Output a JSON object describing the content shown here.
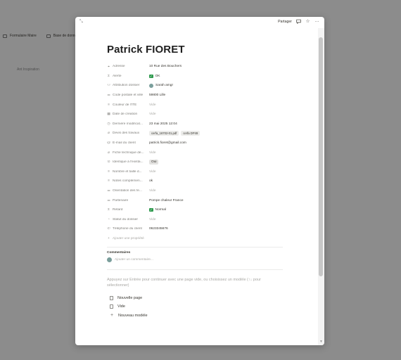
{
  "background": {
    "breadcrumb": [
      {
        "label": "Formulaire Maire",
        "icon": "form-icon"
      },
      {
        "label": "Base de donnée",
        "icon": "table-icon"
      }
    ],
    "sidebar_item": "Ant Inspiration"
  },
  "modal": {
    "share_label": "Partager",
    "page_title": "Patrick FIORET",
    "properties": [
      {
        "name": "Adresse",
        "icon": "location-icon",
        "type": "text",
        "value": "10 Rue des Bouchers"
      },
      {
        "name": "Alerte",
        "icon": "sigma-icon",
        "type": "check",
        "value": "OK"
      },
      {
        "name": "Attribution dossier",
        "icon": "people-icon",
        "type": "person",
        "value": "Sarah amgr"
      },
      {
        "name": "Code postale et ville",
        "icon": "list-icon",
        "type": "text",
        "value": "59800 Lille"
      },
      {
        "name": "Couleur de l'ITE",
        "icon": "text-icon",
        "type": "empty",
        "value": "Vide"
      },
      {
        "name": "Date de création",
        "icon": "calendar-icon",
        "type": "empty",
        "value": "Vide"
      },
      {
        "name": "Dernière modificat...",
        "icon": "clock-icon",
        "type": "text",
        "value": "23 mai 2025 12:04"
      },
      {
        "name": "Devis des travaux",
        "icon": "paperclip-icon",
        "type": "files",
        "files": [
          "cerfa_16702-01.pdf",
          "cerfa DP49"
        ]
      },
      {
        "name": "E-mail du client",
        "icon": "at-icon",
        "type": "text",
        "value": "patrick.fioret@gmail.com"
      },
      {
        "name": "Fiche technique de...",
        "icon": "paperclip-icon",
        "type": "empty",
        "value": "Vide"
      },
      {
        "name": "Identique à l'exista...",
        "icon": "select-icon",
        "type": "tag",
        "value": "Oui"
      },
      {
        "name": "Nombre et taille d...",
        "icon": "text-icon",
        "type": "empty",
        "value": "Vide"
      },
      {
        "name": "Notes complémen...",
        "icon": "text-icon",
        "type": "text",
        "value": "ok"
      },
      {
        "name": "Orientation des fe...",
        "icon": "list-icon",
        "type": "empty",
        "value": "Vide"
      },
      {
        "name": "Partenaire",
        "icon": "list-icon",
        "type": "text",
        "value": "Pompe chaleur France"
      },
      {
        "name": "Retard",
        "icon": "sigma-icon",
        "type": "check",
        "value": "Normal"
      },
      {
        "name": "Statut du dossier",
        "icon": "status-icon",
        "type": "empty",
        "value": "Vide"
      },
      {
        "name": "Téléphone du client",
        "icon": "phone-icon",
        "type": "text",
        "value": "0623345676"
      }
    ],
    "add_property_label": "Ajouter une propriété",
    "comments_heading": "Commentaires",
    "comment_placeholder": "Ajouter un commentaire...",
    "empty_hint": "Appuyez sur Entrée pour continuer avec une page vide, ou choisissez un modèle (↑↓ pour sélectionner)",
    "templates": [
      {
        "label": "Nouvelle page",
        "icon": "page-icon"
      },
      {
        "label": "Vide",
        "icon": "page-icon"
      },
      {
        "label": "Nouveau modèle",
        "icon": "plus-icon"
      }
    ]
  }
}
